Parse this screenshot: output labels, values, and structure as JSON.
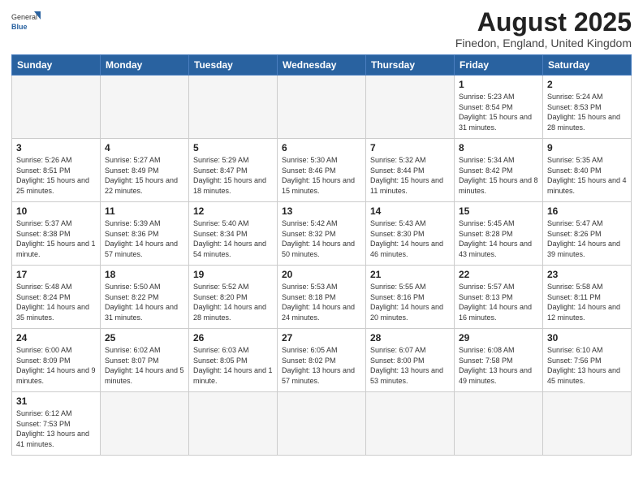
{
  "header": {
    "logo_general": "General",
    "logo_blue": "Blue",
    "month_year": "August 2025",
    "location": "Finedon, England, United Kingdom"
  },
  "days_of_week": [
    "Sunday",
    "Monday",
    "Tuesday",
    "Wednesday",
    "Thursday",
    "Friday",
    "Saturday"
  ],
  "weeks": [
    [
      {
        "day": "",
        "info": ""
      },
      {
        "day": "",
        "info": ""
      },
      {
        "day": "",
        "info": ""
      },
      {
        "day": "",
        "info": ""
      },
      {
        "day": "",
        "info": ""
      },
      {
        "day": "1",
        "info": "Sunrise: 5:23 AM\nSunset: 8:54 PM\nDaylight: 15 hours and 31 minutes."
      },
      {
        "day": "2",
        "info": "Sunrise: 5:24 AM\nSunset: 8:53 PM\nDaylight: 15 hours and 28 minutes."
      }
    ],
    [
      {
        "day": "3",
        "info": "Sunrise: 5:26 AM\nSunset: 8:51 PM\nDaylight: 15 hours and 25 minutes."
      },
      {
        "day": "4",
        "info": "Sunrise: 5:27 AM\nSunset: 8:49 PM\nDaylight: 15 hours and 22 minutes."
      },
      {
        "day": "5",
        "info": "Sunrise: 5:29 AM\nSunset: 8:47 PM\nDaylight: 15 hours and 18 minutes."
      },
      {
        "day": "6",
        "info": "Sunrise: 5:30 AM\nSunset: 8:46 PM\nDaylight: 15 hours and 15 minutes."
      },
      {
        "day": "7",
        "info": "Sunrise: 5:32 AM\nSunset: 8:44 PM\nDaylight: 15 hours and 11 minutes."
      },
      {
        "day": "8",
        "info": "Sunrise: 5:34 AM\nSunset: 8:42 PM\nDaylight: 15 hours and 8 minutes."
      },
      {
        "day": "9",
        "info": "Sunrise: 5:35 AM\nSunset: 8:40 PM\nDaylight: 15 hours and 4 minutes."
      }
    ],
    [
      {
        "day": "10",
        "info": "Sunrise: 5:37 AM\nSunset: 8:38 PM\nDaylight: 15 hours and 1 minute."
      },
      {
        "day": "11",
        "info": "Sunrise: 5:39 AM\nSunset: 8:36 PM\nDaylight: 14 hours and 57 minutes."
      },
      {
        "day": "12",
        "info": "Sunrise: 5:40 AM\nSunset: 8:34 PM\nDaylight: 14 hours and 54 minutes."
      },
      {
        "day": "13",
        "info": "Sunrise: 5:42 AM\nSunset: 8:32 PM\nDaylight: 14 hours and 50 minutes."
      },
      {
        "day": "14",
        "info": "Sunrise: 5:43 AM\nSunset: 8:30 PM\nDaylight: 14 hours and 46 minutes."
      },
      {
        "day": "15",
        "info": "Sunrise: 5:45 AM\nSunset: 8:28 PM\nDaylight: 14 hours and 43 minutes."
      },
      {
        "day": "16",
        "info": "Sunrise: 5:47 AM\nSunset: 8:26 PM\nDaylight: 14 hours and 39 minutes."
      }
    ],
    [
      {
        "day": "17",
        "info": "Sunrise: 5:48 AM\nSunset: 8:24 PM\nDaylight: 14 hours and 35 minutes."
      },
      {
        "day": "18",
        "info": "Sunrise: 5:50 AM\nSunset: 8:22 PM\nDaylight: 14 hours and 31 minutes."
      },
      {
        "day": "19",
        "info": "Sunrise: 5:52 AM\nSunset: 8:20 PM\nDaylight: 14 hours and 28 minutes."
      },
      {
        "day": "20",
        "info": "Sunrise: 5:53 AM\nSunset: 8:18 PM\nDaylight: 14 hours and 24 minutes."
      },
      {
        "day": "21",
        "info": "Sunrise: 5:55 AM\nSunset: 8:16 PM\nDaylight: 14 hours and 20 minutes."
      },
      {
        "day": "22",
        "info": "Sunrise: 5:57 AM\nSunset: 8:13 PM\nDaylight: 14 hours and 16 minutes."
      },
      {
        "day": "23",
        "info": "Sunrise: 5:58 AM\nSunset: 8:11 PM\nDaylight: 14 hours and 12 minutes."
      }
    ],
    [
      {
        "day": "24",
        "info": "Sunrise: 6:00 AM\nSunset: 8:09 PM\nDaylight: 14 hours and 9 minutes."
      },
      {
        "day": "25",
        "info": "Sunrise: 6:02 AM\nSunset: 8:07 PM\nDaylight: 14 hours and 5 minutes."
      },
      {
        "day": "26",
        "info": "Sunrise: 6:03 AM\nSunset: 8:05 PM\nDaylight: 14 hours and 1 minute."
      },
      {
        "day": "27",
        "info": "Sunrise: 6:05 AM\nSunset: 8:02 PM\nDaylight: 13 hours and 57 minutes."
      },
      {
        "day": "28",
        "info": "Sunrise: 6:07 AM\nSunset: 8:00 PM\nDaylight: 13 hours and 53 minutes."
      },
      {
        "day": "29",
        "info": "Sunrise: 6:08 AM\nSunset: 7:58 PM\nDaylight: 13 hours and 49 minutes."
      },
      {
        "day": "30",
        "info": "Sunrise: 6:10 AM\nSunset: 7:56 PM\nDaylight: 13 hours and 45 minutes."
      }
    ],
    [
      {
        "day": "31",
        "info": "Sunrise: 6:12 AM\nSunset: 7:53 PM\nDaylight: 13 hours and 41 minutes."
      },
      {
        "day": "",
        "info": ""
      },
      {
        "day": "",
        "info": ""
      },
      {
        "day": "",
        "info": ""
      },
      {
        "day": "",
        "info": ""
      },
      {
        "day": "",
        "info": ""
      },
      {
        "day": "",
        "info": ""
      }
    ]
  ]
}
